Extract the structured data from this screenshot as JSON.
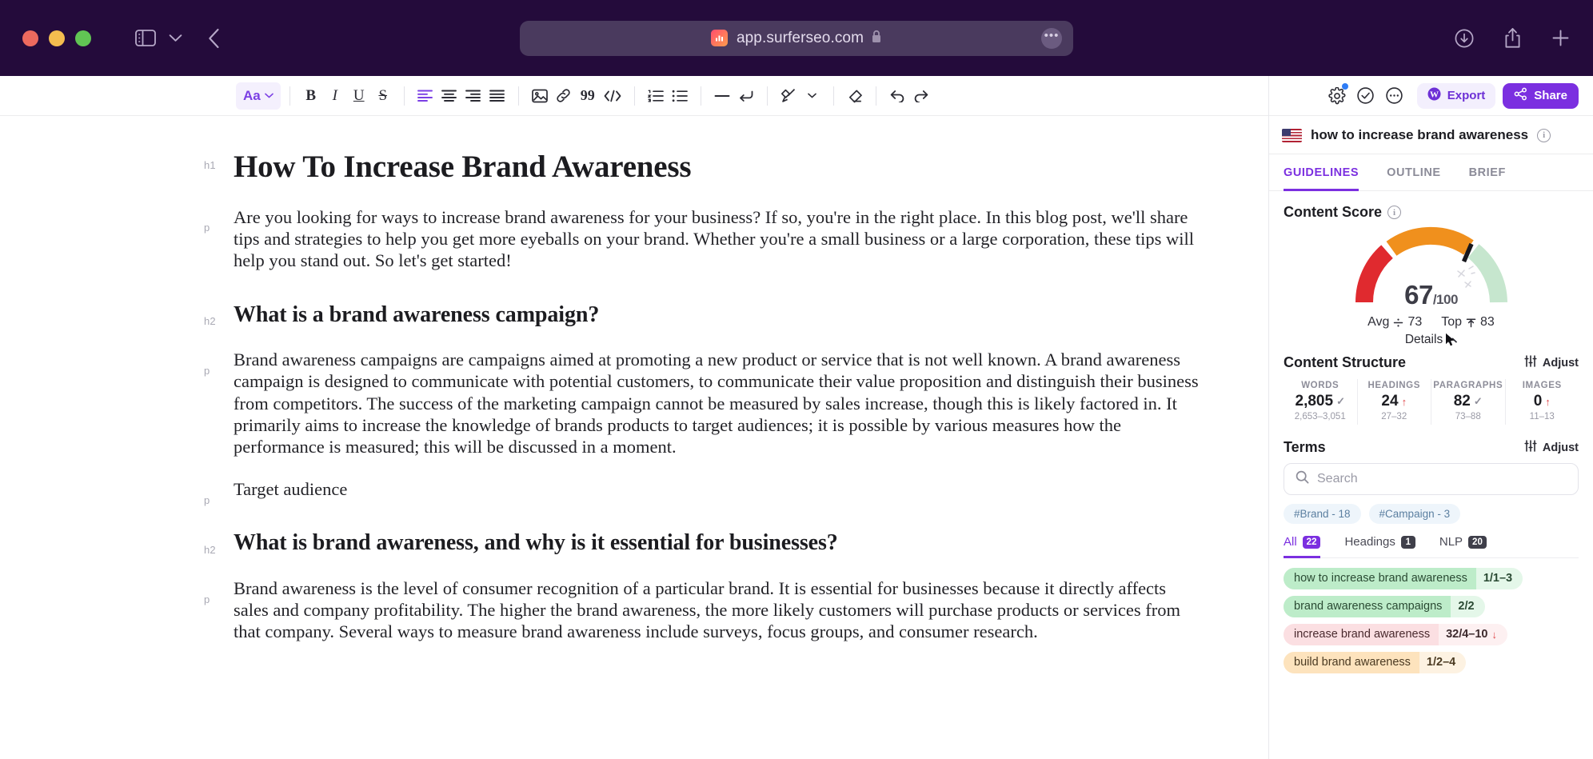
{
  "browser": {
    "url": "app.surferseo.com",
    "favicon_name": "surfer-seo-favicon",
    "lock_label": "secure",
    "more_label": "•••"
  },
  "toolbar": {
    "font_label": "Aa",
    "items": [
      {
        "name": "bold-button",
        "glyph": "B"
      },
      {
        "name": "italic-button",
        "glyph": "I"
      },
      {
        "name": "underline-button",
        "glyph": "U"
      },
      {
        "name": "strikethrough-button",
        "glyph": "S"
      }
    ]
  },
  "document": {
    "blocks": [
      {
        "tag": "h1",
        "type": "h1",
        "text": "How To Increase Brand Awareness"
      },
      {
        "tag": "p",
        "type": "p",
        "text": "Are you looking for ways to increase brand awareness for your business? If so, you're in the right place. In this blog post, we'll share tips and strategies to help you get more eyeballs on your brand. Whether you're a small business or a large corporation, these tips will help you stand out. So let's get started!"
      },
      {
        "tag": "h2",
        "type": "h2",
        "text": "What is a brand awareness campaign?"
      },
      {
        "tag": "p",
        "type": "p",
        "text": "Brand awareness campaigns are campaigns aimed at promoting a new product or service that is not well known. A brand awareness campaign is designed to communicate with potential customers, to communicate their value proposition and distinguish their business from competitors. The success of the marketing campaign cannot be measured by sales increase, though this is likely factored in. It primarily aims to increase the knowledge of brands products to target audiences; it is possible by various measures how the performance is measured; this will be discussed in a moment."
      },
      {
        "tag": "p",
        "type": "p",
        "text": "Target audience"
      },
      {
        "tag": "h2",
        "type": "h2",
        "text": "What is brand awareness, and why is it essential for businesses?"
      },
      {
        "tag": "p",
        "type": "p",
        "text": "Brand awareness is the level of consumer recognition of a particular brand. It is essential for businesses because it directly affects sales and company profitability. The higher the brand awareness, the more likely customers will purchase products or services from that company. Several ways to measure brand awareness include surveys, focus groups, and consumer research."
      }
    ]
  },
  "panel": {
    "export_label": "Export",
    "share_label": "Share",
    "keyword": "how to increase brand awareness",
    "tabs": [
      {
        "label": "GUIDELINES",
        "active": true
      },
      {
        "label": "OUTLINE",
        "active": false
      },
      {
        "label": "BRIEF",
        "active": false
      }
    ],
    "content_score": {
      "title": "Content Score",
      "value": "67",
      "max": "/100",
      "avg_label": "Avg",
      "avg_value": "73",
      "top_label": "Top",
      "top_value": "83",
      "details_label": "Details",
      "colors": {
        "red": "#e02a2f",
        "orange": "#f0901d",
        "green": "#c6e6ce",
        "needle": "#17171c"
      }
    },
    "content_structure": {
      "title": "Content Structure",
      "adjust_label": "Adjust",
      "stats": [
        {
          "label": "WORDS",
          "value": "2,805",
          "status": "check",
          "range": "2,653–3,051"
        },
        {
          "label": "HEADINGS",
          "value": "24",
          "status": "up",
          "range": "27–32"
        },
        {
          "label": "PARAGRAPHS",
          "value": "82",
          "status": "check",
          "range": "73–88"
        },
        {
          "label": "IMAGES",
          "value": "0",
          "status": "up",
          "range": "11–13"
        }
      ]
    },
    "terms": {
      "title": "Terms",
      "adjust_label": "Adjust",
      "search_placeholder": "Search",
      "search_value": "",
      "hash_tags": [
        "#Brand - 18",
        "#Campaign - 3"
      ],
      "tabs": [
        {
          "label": "All",
          "count": "22",
          "active": true
        },
        {
          "label": "Headings",
          "count": "1",
          "active": false
        },
        {
          "label": "NLP",
          "count": "20",
          "active": false
        }
      ],
      "list": [
        {
          "name": "how to increase brand awareness",
          "count": "1/1–3",
          "color": "green",
          "trend": ""
        },
        {
          "name": "brand awareness campaigns",
          "count": "2/2",
          "color": "green",
          "trend": ""
        },
        {
          "name": "increase brand awareness",
          "count": "32/4–10",
          "color": "pink",
          "trend": "↓"
        },
        {
          "name": "build brand awareness",
          "count": "1/2–4",
          "color": "orange",
          "trend": ""
        }
      ]
    }
  },
  "chart_data": {
    "type": "gauge",
    "title": "Content Score",
    "value": 67,
    "min": 0,
    "max": 100,
    "benchmarks": [
      {
        "name": "Avg",
        "value": 73
      },
      {
        "name": "Top",
        "value": 83
      }
    ],
    "bands": [
      {
        "name": "low",
        "range": [
          0,
          33
        ],
        "color": "#e02a2f"
      },
      {
        "name": "mid",
        "range": [
          33,
          66
        ],
        "color": "#f0901d"
      },
      {
        "name": "high",
        "range": [
          66,
          100
        ],
        "color": "#c6e6ce"
      }
    ],
    "ylabel": "",
    "xlabel": ""
  }
}
